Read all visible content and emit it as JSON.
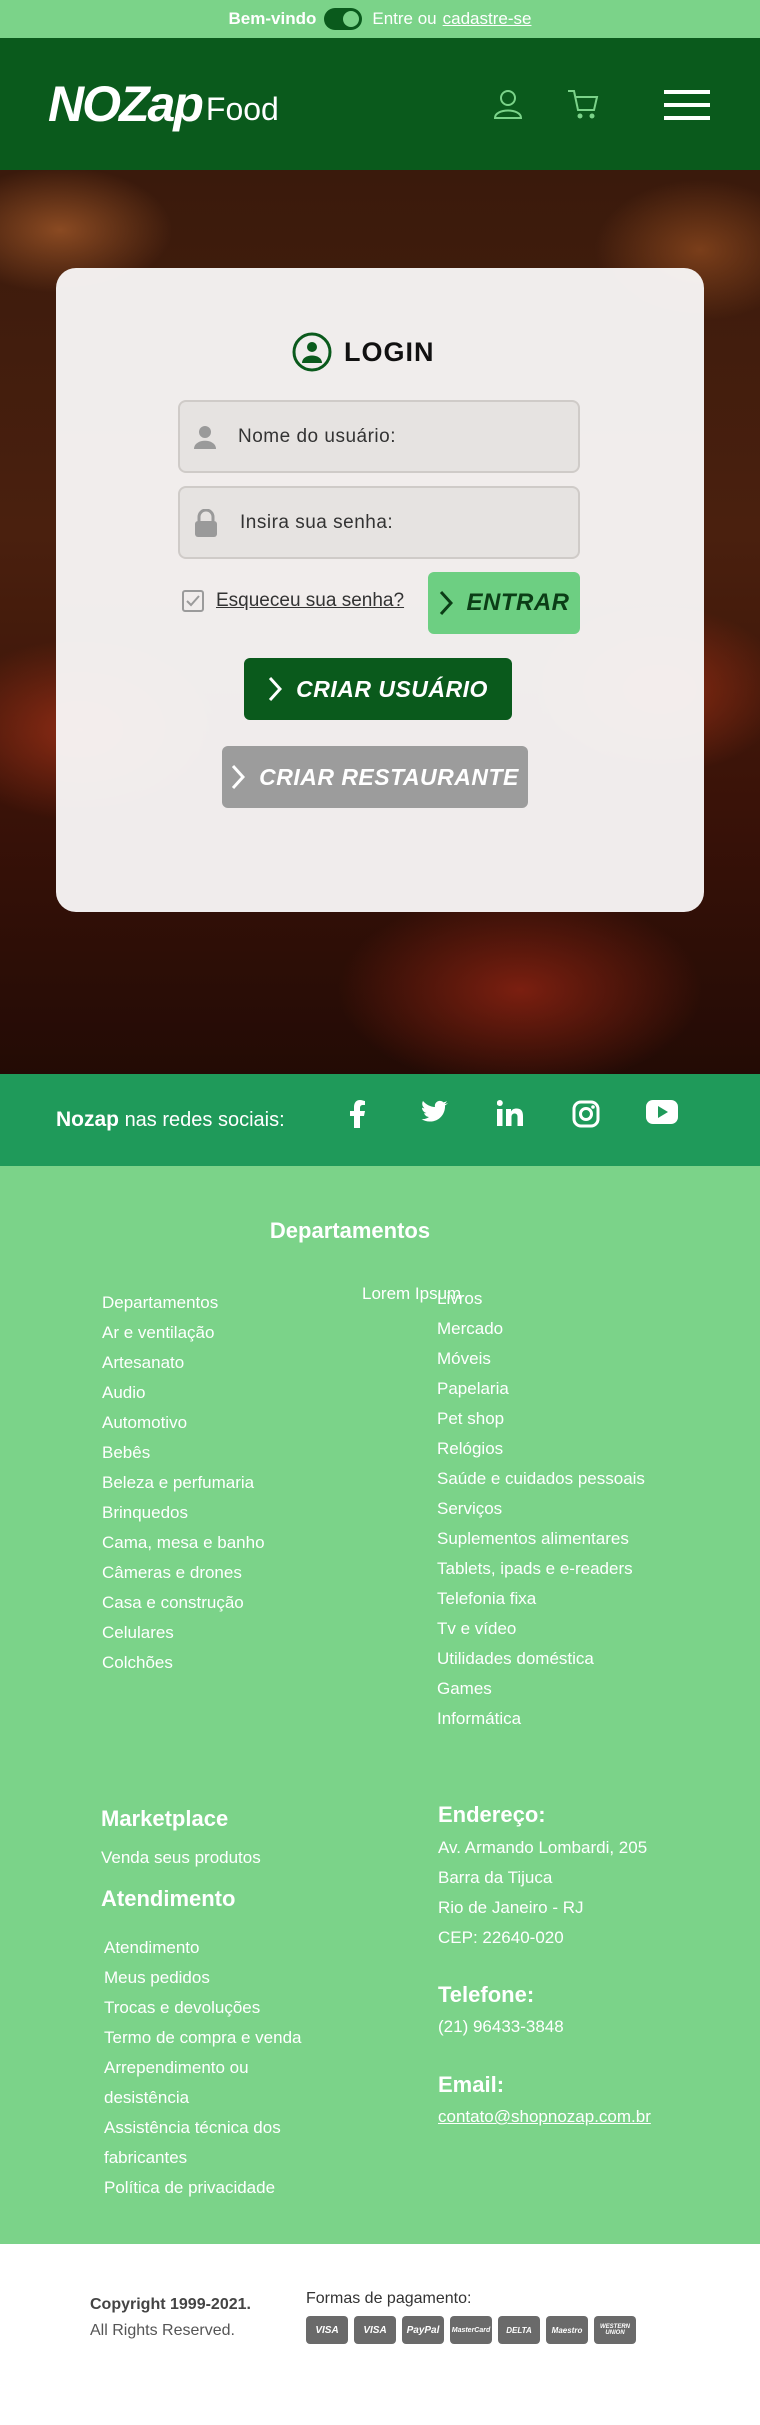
{
  "topbar": {
    "welcome": "Bem-vindo",
    "enter_text": "Entre ou",
    "signup_link": "cadastre-se"
  },
  "header": {
    "brand": "NOZap",
    "brand_suffix": "Food",
    "icons": [
      "user-icon",
      "cart-icon",
      "menu-icon"
    ]
  },
  "login": {
    "title": "LOGIN",
    "username_placeholder": "Nome do usuário:",
    "password_placeholder": "Insira sua senha:",
    "forgot_label": "Esqueceu sua senha?",
    "enter_button": "ENTRAR",
    "create_user_button": "CRIAR USUÁRIO",
    "create_restaurant_button": "CRIAR RESTAURANTE"
  },
  "social": {
    "brand": "Nozap",
    "label": "nas redes sociais:",
    "networks": [
      "facebook-icon",
      "twitter-icon",
      "linkedin-icon",
      "instagram-icon",
      "youtube-icon"
    ]
  },
  "departments": {
    "title": "Departamentos",
    "lorem": "Lorem Ipsum",
    "left": [
      "Departamentos",
      "Ar e ventilação",
      "Artesanato",
      "Audio",
      "Automotivo",
      "Bebês",
      "Beleza e perfumaria",
      "Brinquedos",
      "Cama, mesa e banho",
      "Câmeras e drones",
      "Casa e construção",
      "Celulares",
      "Colchões"
    ],
    "right": [
      "Livros",
      "Mercado",
      "Móveis",
      "Papelaria",
      "Pet shop",
      "Relógios",
      "Saúde e cuidados pessoais",
      "Serviços",
      "Suplementos alimentares",
      "Tablets, ipads e e-readers",
      "Telefonia fixa",
      "Tv e vídeo",
      "Utilidades doméstica",
      "Games",
      "Informática"
    ]
  },
  "marketplace": {
    "title": "Marketplace",
    "item": "Venda seus produtos"
  },
  "atendimento": {
    "title": "Atendimento",
    "items": [
      "Atendimento",
      "Meus pedidos",
      "Trocas e devoluções",
      "Termo de compra e venda",
      "Arrependimento ou",
      "desistência",
      "Assistência técnica dos",
      "fabricantes",
      "Política de privacidade"
    ]
  },
  "contact": {
    "address_title": "Endereço:",
    "address_lines": [
      "Av. Armando Lombardi, 205",
      "Barra da Tijuca",
      "Rio de Janeiro - RJ",
      "CEP: 22640-020"
    ],
    "phone_title": "Telefone:",
    "phone": "(21) 96433-3848",
    "email_title": "Email:",
    "email": "contato@shopnozap.com.br"
  },
  "bottom": {
    "copyright": "Copyright 1999-2021.",
    "rights": "All Rights Reserved.",
    "payments_label": "Formas de pagamento:",
    "payments": [
      "VISA",
      "VISA",
      "PayPal",
      "MasterCard",
      "DELTA",
      "Maestro",
      "WESTERN UNION"
    ]
  },
  "colors": {
    "light_green": "#7bd389",
    "dark_green": "#0a5a1c",
    "social_green": "#1f9a5a",
    "grey_button": "#9c9c9c"
  }
}
